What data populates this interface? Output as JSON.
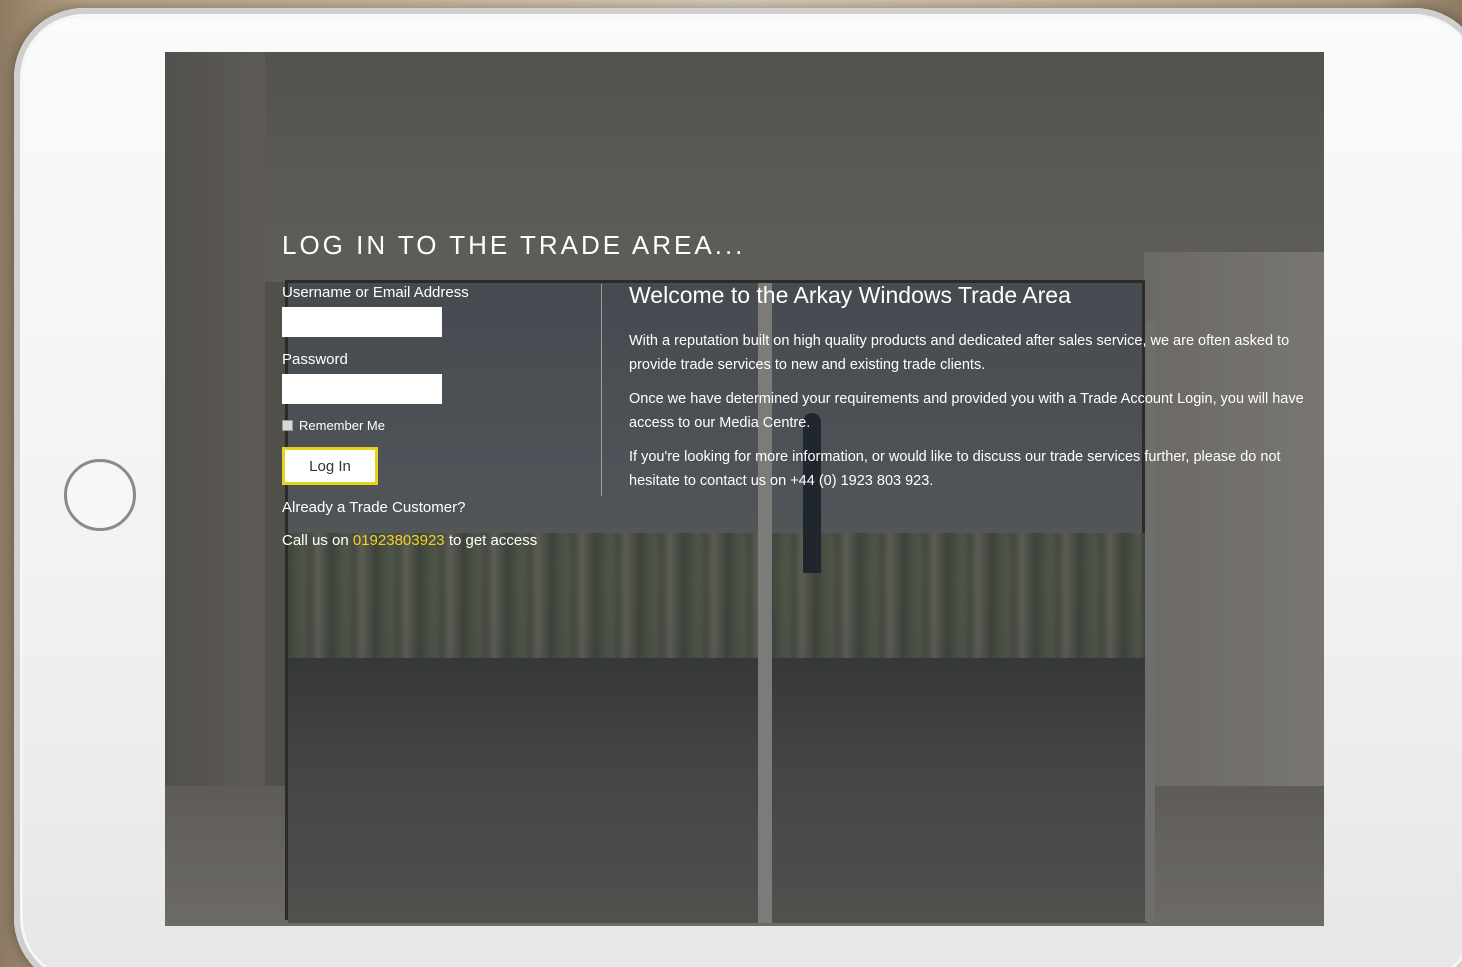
{
  "page": {
    "title": "LOG IN TO THE TRADE AREA..."
  },
  "login": {
    "username_label": "Username or Email Address",
    "username_value": "",
    "password_label": "Password",
    "password_value": "",
    "remember_label": "Remember Me",
    "button_label": "Log In",
    "trade_customer_text": "Already a Trade Customer?",
    "call_prefix": "Call us on",
    "phone_number": "01923803923",
    "call_suffix": "to get access"
  },
  "welcome": {
    "title": "Welcome to the Arkay Windows Trade Area",
    "paragraph1": "With a reputation built on high quality products and dedicated after sales service, we are often asked to provide trade services to new and existing trade clients.",
    "paragraph2": "Once we have determined your requirements and provided you with a Trade Account Login, you will have access to our Media Centre.",
    "paragraph3": "If you're looking for more information, or would like to discuss our trade services further, please do not hesitate to contact us on +44 (0) 1923 803 923."
  },
  "colors": {
    "accent": "#f3d322",
    "button_border": "#e6d31e",
    "text": "#ffffff"
  }
}
